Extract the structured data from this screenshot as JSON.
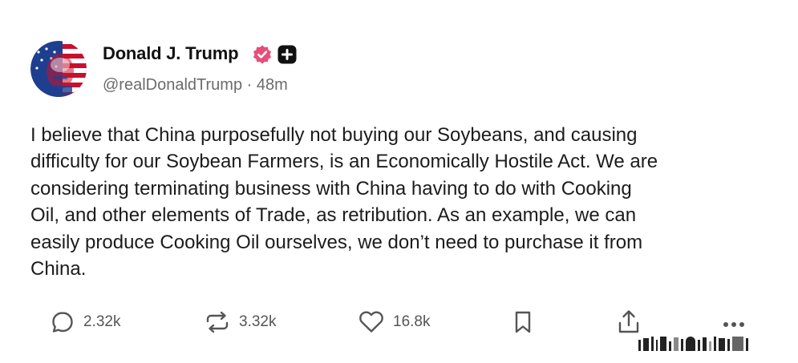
{
  "author": {
    "display_name": "Donald J. Trump",
    "handle": "@realDonaldTrump",
    "separator": "·",
    "time_ago": "48m",
    "verified_icon": "verified-badge-icon",
    "plus_icon": "plus-badge-icon",
    "avatar_colors": [
      "#1e3f8f",
      "#c8102e",
      "#ffffff"
    ]
  },
  "post": {
    "text": "I believe that China purposefully not buying our Soybeans, and causing\ndifficulty for our Soybean Farmers, is an Economically Hostile Act. We are\nconsidering terminating business with China having to do with Cooking\nOil, and other elements of Trade, as retribution. As an example, we can\neasily produce Cooking Oil ourselves, we don’t need to purchase it from\nChina."
  },
  "actions": {
    "replies": {
      "icon": "reply-icon",
      "count": "2.32k"
    },
    "retruths": {
      "icon": "retruth-icon",
      "count": "3.32k"
    },
    "likes": {
      "icon": "heart-icon",
      "count": "16.8k"
    },
    "bookmark": {
      "icon": "bookmark-icon"
    },
    "share": {
      "icon": "share-icon"
    },
    "more": {
      "icon": "more-options-icon"
    }
  },
  "colors": {
    "text_primary": "#1c1c1c",
    "text_secondary": "#6b6b6b",
    "verified_pink": "#e84e7a",
    "icon_gray": "#555555"
  }
}
